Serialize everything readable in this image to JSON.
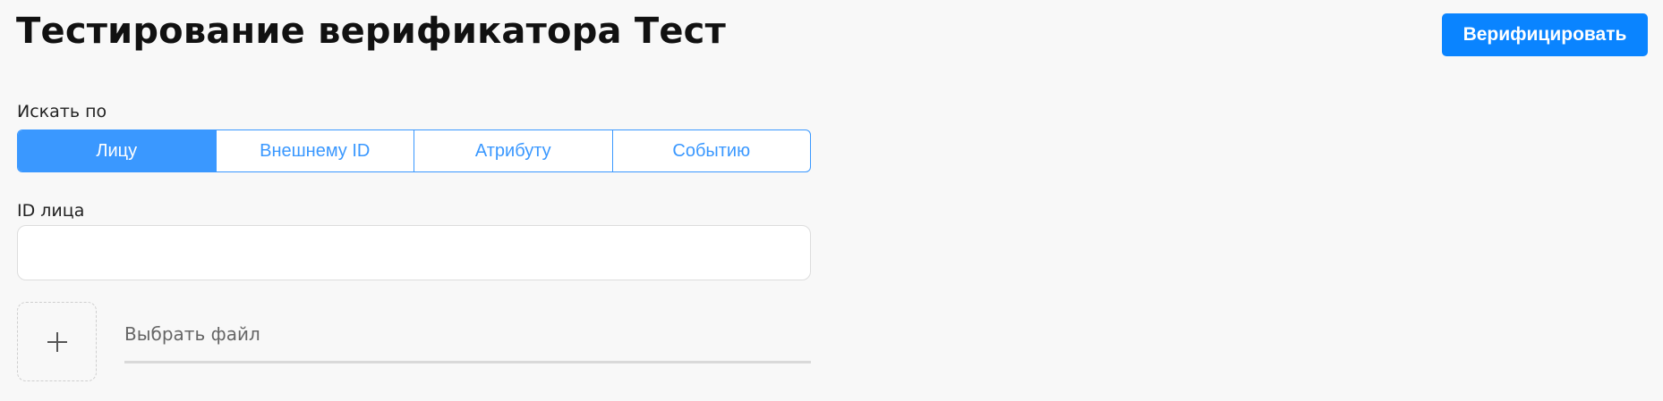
{
  "header": {
    "title": "Тестирование верификатора Тест",
    "verify_button_label": "Верифицировать"
  },
  "search": {
    "label": "Искать по",
    "options": [
      {
        "label": "Лицу",
        "active": true
      },
      {
        "label": "Внешнему ID",
        "active": false
      },
      {
        "label": "Атрибуту",
        "active": false
      },
      {
        "label": "Событию",
        "active": false
      }
    ]
  },
  "face_id": {
    "label": "ID лица",
    "value": "",
    "placeholder": ""
  },
  "file": {
    "label": "Выбрать файл",
    "add_icon": "plus-icon"
  },
  "colors": {
    "accent": "#0a84ff",
    "segment_accent": "#3a98ff",
    "background": "#f8f8f8"
  }
}
